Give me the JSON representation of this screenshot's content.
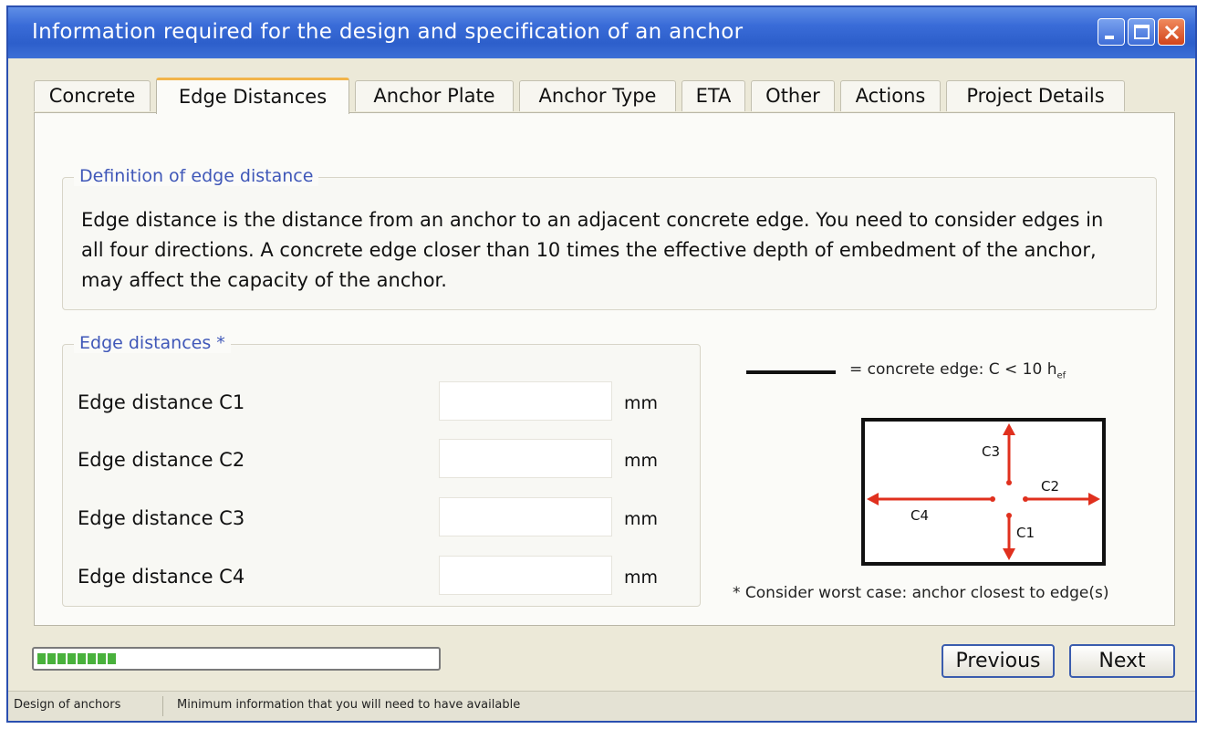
{
  "window": {
    "title": "Information required for the design and specification of an anchor"
  },
  "tabs": [
    {
      "label": "Concrete"
    },
    {
      "label": "Edge Distances",
      "active": true
    },
    {
      "label": "Anchor Plate"
    },
    {
      "label": "Anchor Type"
    },
    {
      "label": "ETA"
    },
    {
      "label": "Other"
    },
    {
      "label": "Actions"
    },
    {
      "label": "Project Details"
    }
  ],
  "definition": {
    "legend": "Definition of edge distance",
    "text": "Edge distance is the distance from an anchor to an adjacent concrete edge. You need to consider edges in all four directions. A concrete edge closer than 10 times the effective depth of embedment of the anchor, may affect the capacity of the anchor."
  },
  "edge_distances": {
    "legend": "Edge distances *",
    "rows": [
      {
        "label": "Edge distance C1",
        "value": "",
        "unit": "mm"
      },
      {
        "label": "Edge distance C2",
        "value": "",
        "unit": "mm"
      },
      {
        "label": "Edge distance C3",
        "value": "",
        "unit": "mm"
      },
      {
        "label": "Edge distance C4",
        "value": "",
        "unit": "mm"
      }
    ]
  },
  "diagram": {
    "legend_text": "= concrete edge: C < 10 h",
    "legend_subscript": "ef",
    "labels": {
      "c1": "C1",
      "c2": "C2",
      "c3": "C3",
      "c4": "C4"
    },
    "arrow_color": "#e0301e",
    "note": "* Consider worst case: anchor closest to edge(s)"
  },
  "progress": {
    "fraction": 0.2
  },
  "buttons": {
    "previous": "Previous",
    "next": "Next"
  },
  "statusbar": {
    "section": "Design of anchors",
    "message": "Minimum information that you will need to have available"
  },
  "colors": {
    "title_bar": "#3a6cd8",
    "active_tab_accent": "#f2b44a",
    "legend_text": "#3f57b8",
    "progress_fill": "#49b13c"
  }
}
